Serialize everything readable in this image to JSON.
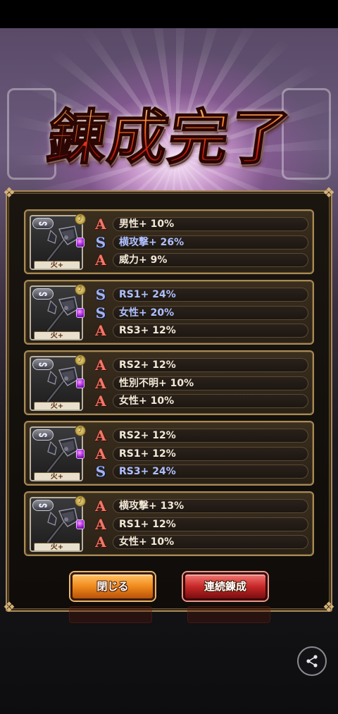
{
  "title": "錬成完了",
  "cards": [
    {
      "element": "火+",
      "stats": [
        {
          "rank": "A",
          "text": "男性+ 10%"
        },
        {
          "rank": "S",
          "text": "横攻撃+ 26%"
        },
        {
          "rank": "A",
          "text": "威力+ 9%"
        }
      ]
    },
    {
      "element": "火+",
      "stats": [
        {
          "rank": "S",
          "text": "RS1+ 24%"
        },
        {
          "rank": "S",
          "text": "女性+ 20%"
        },
        {
          "rank": "A",
          "text": "RS3+ 12%"
        }
      ]
    },
    {
      "element": "火+",
      "stats": [
        {
          "rank": "A",
          "text": "RS2+ 12%"
        },
        {
          "rank": "A",
          "text": "性別不明+ 10%"
        },
        {
          "rank": "A",
          "text": "女性+ 10%"
        }
      ]
    },
    {
      "element": "火+",
      "stats": [
        {
          "rank": "A",
          "text": "RS2+ 12%"
        },
        {
          "rank": "A",
          "text": "RS1+ 12%"
        },
        {
          "rank": "S",
          "text": "RS3+ 24%"
        }
      ]
    },
    {
      "element": "火+",
      "stats": [
        {
          "rank": "A",
          "text": "横攻撃+ 13%"
        },
        {
          "rank": "A",
          "text": "RS1+ 12%"
        },
        {
          "rank": "A",
          "text": "女性+ 10%"
        }
      ]
    }
  ],
  "buttons": {
    "close_label": "閉じる",
    "continue_label": "連続錬成"
  },
  "icons": {
    "share": "share-icon",
    "weapon": "axe-icon",
    "rank_a": "rank-a-icon",
    "rank_s": "rank-s-icon"
  },
  "colors": {
    "rank_a": "#f07868",
    "rank_s": "#a2b4f0",
    "close_button": "#f08a1c",
    "continue_button": "#c82828",
    "frame_gold": "#a78a55"
  }
}
